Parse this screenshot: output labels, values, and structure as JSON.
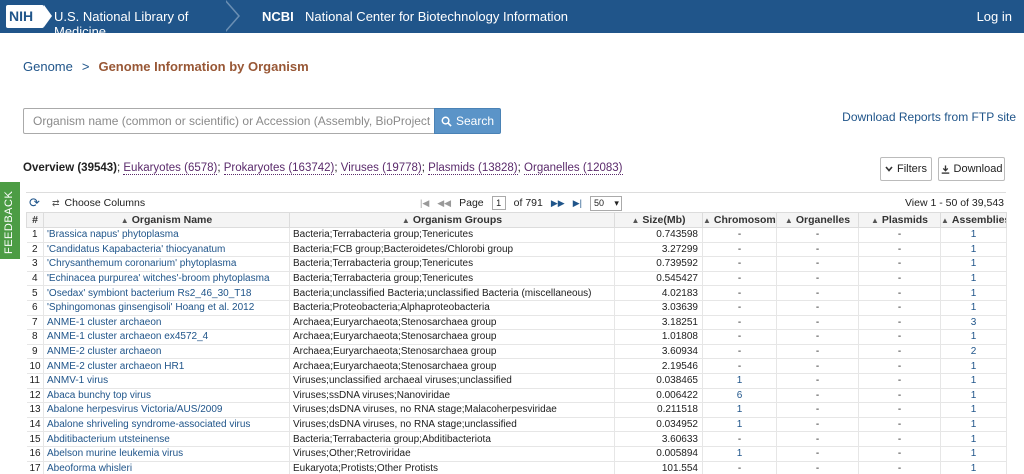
{
  "header": {
    "nih_logo": "NIH",
    "nlm_title": "U.S. National Library of Medicine",
    "ncbi_logo": "NCBI",
    "ncbi_title": "National Center for Biotechnology Information",
    "login": "Log in"
  },
  "breadcrumb": {
    "root": "Genome",
    "separator": ">",
    "current": "Genome Information by Organism"
  },
  "search": {
    "placeholder": "Organism name (common or scientific) or Accession (Assembly, BioProject or replic",
    "button_label": "Search"
  },
  "ftp_link": "Download Reports from FTP site",
  "overview": {
    "label": "Overview (39543)",
    "sep": ";",
    "eukaryotes": "Eukaryotes (6578)",
    "prokaryotes": "Prokaryotes (163742)",
    "viruses": "Viruses (19778)",
    "plasmids": "Plasmids (13828)",
    "organelles": "Organelles (12083)"
  },
  "buttons": {
    "filters": "Filters",
    "download": "Download"
  },
  "feedback": "FEEDBACK",
  "toolbar": {
    "choose_columns": "Choose Columns",
    "page_label": "Page",
    "page_value": "1",
    "page_of": "of 791",
    "page_size": "50",
    "view_text": "View 1 - 50 of 39,543"
  },
  "table": {
    "columns": [
      "#",
      "Organism Name",
      "Organism Groups",
      "Size(Mb)",
      "Chromosomes",
      "Organelles",
      "Plasmids",
      "Assemblies"
    ],
    "rows": [
      [
        "1",
        "'Brassica napus' phytoplasma",
        "Bacteria;Terrabacteria group;Tenericutes",
        "0.743598",
        "-",
        "-",
        "-",
        "1"
      ],
      [
        "2",
        "'Candidatus Kapabacteria' thiocyanatum",
        "Bacteria;FCB group;Bacteroidetes/Chlorobi group",
        "3.27299",
        "-",
        "-",
        "-",
        "1"
      ],
      [
        "3",
        "'Chrysanthemum coronarium' phytoplasma",
        "Bacteria;Terrabacteria group;Tenericutes",
        "0.739592",
        "-",
        "-",
        "-",
        "1"
      ],
      [
        "4",
        "'Echinacea purpurea' witches'-broom phytoplasma",
        "Bacteria;Terrabacteria group;Tenericutes",
        "0.545427",
        "-",
        "-",
        "-",
        "1"
      ],
      [
        "5",
        "'Osedax' symbiont bacterium Rs2_46_30_T18",
        "Bacteria;unclassified Bacteria;unclassified Bacteria (miscellaneous)",
        "4.02183",
        "-",
        "-",
        "-",
        "1"
      ],
      [
        "6",
        "'Sphingomonas ginsengisoli' Hoang et al. 2012",
        "Bacteria;Proteobacteria;Alphaproteobacteria",
        "3.03639",
        "-",
        "-",
        "-",
        "1"
      ],
      [
        "7",
        "ANME-1 cluster archaeon",
        "Archaea;Euryarchaeota;Stenosarchaea group",
        "3.18251",
        "-",
        "-",
        "-",
        "3"
      ],
      [
        "8",
        "ANME-1 cluster archaeon ex4572_4",
        "Archaea;Euryarchaeota;Stenosarchaea group",
        "1.01808",
        "-",
        "-",
        "-",
        "1"
      ],
      [
        "9",
        "ANME-2 cluster archaeon",
        "Archaea;Euryarchaeota;Stenosarchaea group",
        "3.60934",
        "-",
        "-",
        "-",
        "2"
      ],
      [
        "10",
        "ANME-2 cluster archaeon HR1",
        "Archaea;Euryarchaeota;Stenosarchaea group",
        "2.19546",
        "-",
        "-",
        "-",
        "1"
      ],
      [
        "11",
        "ANMV-1 virus",
        "Viruses;unclassified archaeal viruses;unclassified",
        "0.038465",
        "1",
        "-",
        "-",
        "1"
      ],
      [
        "12",
        "Abaca bunchy top virus",
        "Viruses;ssDNA viruses;Nanoviridae",
        "0.006422",
        "6",
        "-",
        "-",
        "1"
      ],
      [
        "13",
        "Abalone herpesvirus Victoria/AUS/2009",
        "Viruses;dsDNA viruses, no RNA stage;Malacoherpesviridae",
        "0.211518",
        "1",
        "-",
        "-",
        "1"
      ],
      [
        "14",
        "Abalone shriveling syndrome-associated virus",
        "Viruses;dsDNA viruses, no RNA stage;unclassified",
        "0.034952",
        "1",
        "-",
        "-",
        "1"
      ],
      [
        "15",
        "Abditibacterium utsteinense",
        "Bacteria;Terrabacteria group;Abditibacteriota",
        "3.60633",
        "-",
        "-",
        "-",
        "1"
      ],
      [
        "16",
        "Abelson murine leukemia virus",
        "Viruses;Other;Retroviridae",
        "0.005894",
        "1",
        "-",
        "-",
        "1"
      ],
      [
        "17",
        "Abeoforma whisleri",
        "Eukaryota;Protists;Other Protists",
        "101.554",
        "-",
        "-",
        "-",
        "1"
      ]
    ]
  }
}
